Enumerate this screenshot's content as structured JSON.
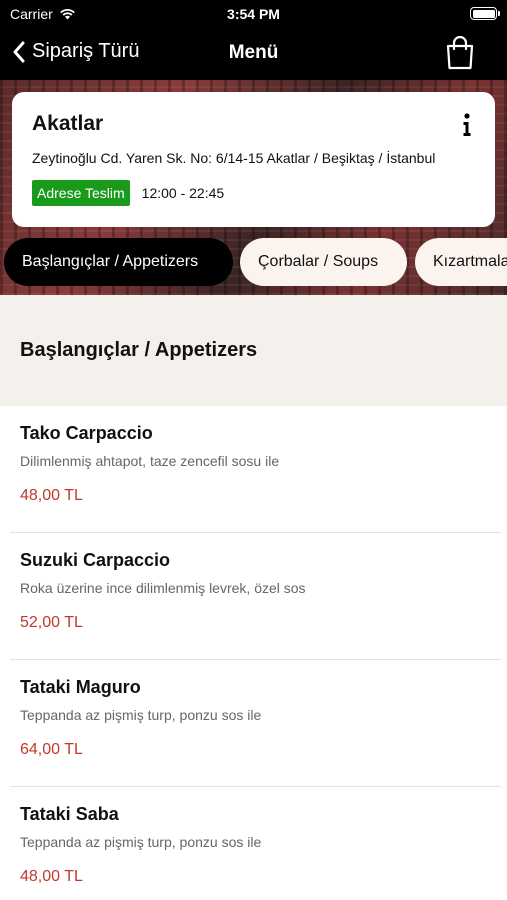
{
  "status_bar": {
    "carrier": "Carrier",
    "time": "3:54 PM"
  },
  "nav": {
    "back_label": "Sipariş Türü",
    "title": "Menü"
  },
  "restaurant": {
    "name": "Akatlar",
    "address": "Zeytinoğlu Cd. Yaren Sk. No: 6/14-15 Akatlar / Beşiktaş / İstanbul",
    "delivery_badge": "Adrese Teslim",
    "hours": "12:00 - 22:45"
  },
  "tabs": [
    {
      "label": "Başlangıçlar / Appetizers",
      "active": true
    },
    {
      "label": "Çorbalar / Soups",
      "active": false
    },
    {
      "label": "Kızartmalar",
      "active": false
    }
  ],
  "section": {
    "title": "Başlangıçlar / Appetizers"
  },
  "items": [
    {
      "name": "Tako Carpaccio",
      "description": "Dilimlenmiş ahtapot, taze zencefil sosu ile",
      "price": "48,00 TL"
    },
    {
      "name": "Suzuki Carpaccio",
      "description": "Roka üzerine ince dilimlenmiş levrek, özel sos",
      "price": "52,00 TL"
    },
    {
      "name": "Tataki Maguro",
      "description": "Teppanda az pişmiş turp, ponzu sos ile",
      "price": "64,00 TL"
    },
    {
      "name": "Tataki Saba",
      "description": "Teppanda az pişmiş turp, ponzu sos ile",
      "price": "48,00 TL"
    }
  ],
  "colors": {
    "badge": "#1a9a1a",
    "price": "#c0392b",
    "header_bg": "#000000",
    "section_bg": "#f4f0ec"
  }
}
